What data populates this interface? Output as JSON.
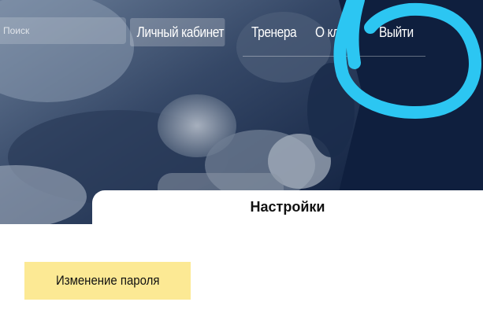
{
  "search": {
    "placeholder": "Поиск"
  },
  "nav": {
    "items": [
      {
        "label": "Личный кабинет",
        "active": true
      },
      {
        "label": "Тренера",
        "active": false
      },
      {
        "label": "О клубе",
        "active": false
      },
      {
        "label": "Выйти",
        "active": false
      }
    ]
  },
  "annotation": {
    "color": "#2cc6f2",
    "shape": "circle"
  },
  "settings": {
    "title": "Настройки",
    "change_password_label": "Изменение пароля"
  },
  "colors": {
    "hero_background": "#0f1f3e",
    "button_background": "#fce994"
  }
}
